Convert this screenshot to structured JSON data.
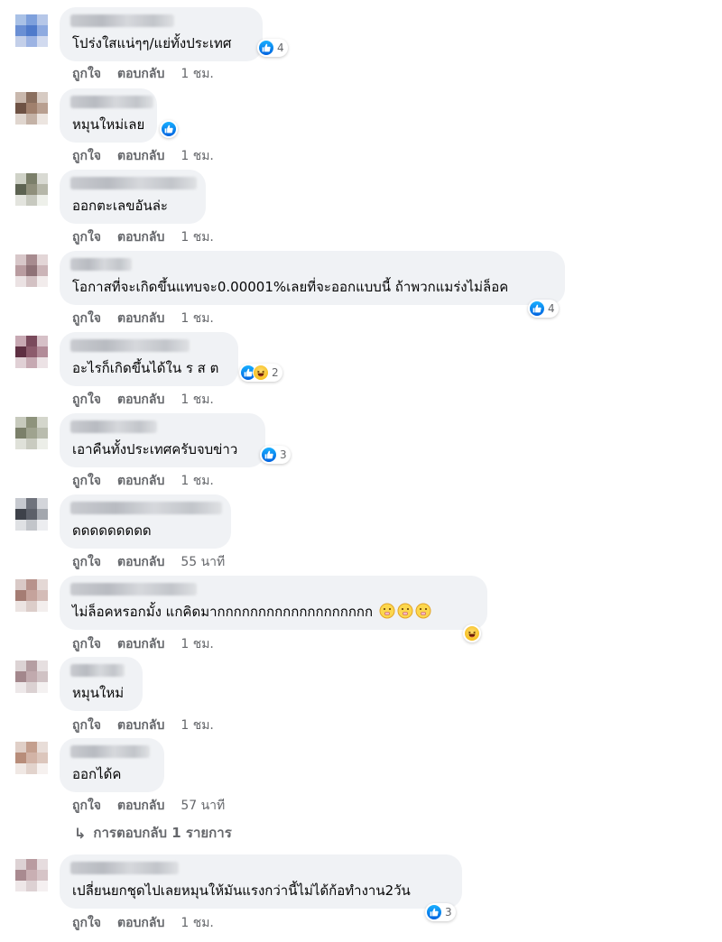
{
  "actions": {
    "like": "ถูกใจ",
    "reply": "ตอบกลับ"
  },
  "comments": [
    {
      "text": "โปร่งใสแน่ๆๆ/แย่ทั้งประเทศ",
      "reaction_count": "4",
      "time": "1 ชม."
    },
    {
      "text": "หมุนใหม่เลย",
      "reaction_count": "",
      "time": "1 ชม."
    },
    {
      "text": "ออกตะเลขอันล่ะ",
      "reaction_count": "",
      "time": "1 ชม."
    },
    {
      "text": "โอกาสที่จะเกิดขึ้นแทบจะ0.00001%เลยที่จะออกแบบนี้ ถ้าพวกแมร่งไม่ล็อค",
      "reaction_count": "4",
      "time": "1 ชม."
    },
    {
      "text": "อะไรก็เกิดขึ้นได้ใน ร ส ต",
      "reaction_count": "2",
      "time": "1 ชม."
    },
    {
      "text": "เอาคืนทั้งประเทศครับจบข่าว",
      "reaction_count": "3",
      "time": "1 ชม."
    },
    {
      "text": "ดดดดดดดดด",
      "reaction_count": "",
      "time": "55 นาที"
    },
    {
      "text": "ไม่ล็อคหรอกมั้ง แกคิดมากกกกกกกกกกกกกกกกกกก",
      "reaction_count": "",
      "time": "1 ชม."
    },
    {
      "text": "หมุนใหม่",
      "reaction_count": "",
      "time": "1 ชม."
    },
    {
      "text": "ออกได้ค",
      "reaction_count": "",
      "time": "57 นาที"
    },
    {
      "text": "เปลี่ยนยกชุดไปเลยหมุนให้มันแรงกว่านี้ไม่ได้ก้อทำงาน2วัน",
      "reaction_count": "3",
      "time": "1 ชม."
    }
  ],
  "replies_link": "การตอบกลับ 1 รายการ",
  "colors": {
    "bubble": "#f0f2f5",
    "meta": "#65676b",
    "like_blue": "#1877f2"
  }
}
